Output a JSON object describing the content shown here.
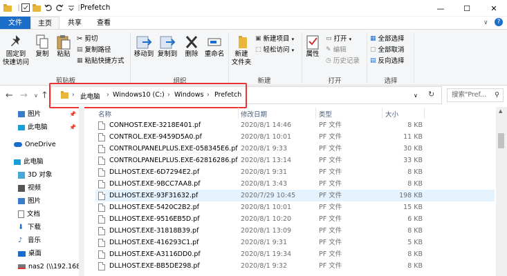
{
  "window": {
    "title": "Prefetch",
    "minimize": "—",
    "maximize": "☐",
    "close": "✕"
  },
  "tabs": [
    {
      "label": "文件"
    },
    {
      "label": "主页"
    },
    {
      "label": "共享"
    },
    {
      "label": "查看"
    }
  ],
  "ribbon": {
    "clipboard": {
      "pin_label": "固定到\n快速访问",
      "copy_label": "复制",
      "paste_label": "粘贴",
      "cut": "剪切",
      "copy_path": "复制路径",
      "paste_shortcut": "粘贴快捷方式",
      "group_label": "剪贴板"
    },
    "organize": {
      "move_to": "移动到",
      "copy_to": "复制到",
      "delete": "删除",
      "rename": "重命名",
      "group_label": "组织"
    },
    "new": {
      "new_folder": "新建\n文件夹",
      "new_item": "新建项目",
      "easy_access": "轻松访问",
      "group_label": "新建"
    },
    "open": {
      "properties": "属性",
      "open": "打开",
      "edit": "编辑",
      "history": "历史记录",
      "group_label": "打开"
    },
    "select": {
      "select_all": "全部选择",
      "select_none": "全部取消",
      "invert": "反向选择",
      "group_label": "选择"
    }
  },
  "address": {
    "crumbs": [
      "此电脑",
      "Windows10 (C:)",
      "Windows",
      "Prefetch"
    ],
    "search_placeholder": "搜索\"Pref..."
  },
  "sidebar": {
    "items": [
      {
        "label": "图片"
      },
      {
        "label": "此电脑"
      },
      {
        "label": "OneDrive"
      },
      {
        "label": "此电脑"
      },
      {
        "label": "3D 对象"
      },
      {
        "label": "视频"
      },
      {
        "label": "图片"
      },
      {
        "label": "文档"
      },
      {
        "label": "下载"
      },
      {
        "label": "音乐"
      },
      {
        "label": "桌面"
      },
      {
        "label": "nas2 (\\\\192.168"
      }
    ]
  },
  "columns": {
    "name": "名称",
    "date": "修改日期",
    "type": "类型",
    "size": "大小"
  },
  "files": [
    {
      "name": "CONHOST.EXE-3218E401.pf",
      "date": "2020/8/1 14:46",
      "type": "PF 文件",
      "size": "8 KB"
    },
    {
      "name": "CONTROL.EXE-9459D5A0.pf",
      "date": "2020/8/1 10:01",
      "type": "PF 文件",
      "size": "11 KB"
    },
    {
      "name": "CONTROLPANELPLUS.EXE-058345E6.pf",
      "date": "2020/8/1 9:33",
      "type": "PF 文件",
      "size": "30 KB"
    },
    {
      "name": "CONTROLPANELPLUS.EXE-62816286.pf",
      "date": "2020/8/1 13:14",
      "type": "PF 文件",
      "size": "33 KB"
    },
    {
      "name": "DLLHOST.EXE-6D7294E2.pf",
      "date": "2020/8/1 9:31",
      "type": "PF 文件",
      "size": "8 KB"
    },
    {
      "name": "DLLHOST.EXE-9BCC7AA8.pf",
      "date": "2020/8/1 3:43",
      "type": "PF 文件",
      "size": "8 KB"
    },
    {
      "name": "DLLHOST.EXE-93F31632.pf",
      "date": "2020/7/29 10:45",
      "type": "PF 文件",
      "size": "198 KB"
    },
    {
      "name": "DLLHOST.EXE-5420C2B2.pf",
      "date": "2020/8/1 10:01",
      "type": "PF 文件",
      "size": "15 KB"
    },
    {
      "name": "DLLHOST.EXE-9516EB5D.pf",
      "date": "2020/8/1 10:20",
      "type": "PF 文件",
      "size": "6 KB"
    },
    {
      "name": "DLLHOST.EXE-31818B39.pf",
      "date": "2020/8/1 13:09",
      "type": "PF 文件",
      "size": "8 KB"
    },
    {
      "name": "DLLHOST.EXE-416293C1.pf",
      "date": "2020/8/1 9:31",
      "type": "PF 文件",
      "size": "5 KB"
    },
    {
      "name": "DLLHOST.EXE-A3116DD0.pf",
      "date": "2020/8/1 19:34",
      "type": "PF 文件",
      "size": "8 KB"
    },
    {
      "name": "DLLHOST.EXE-BB5DE298.pf",
      "date": "2020/8/1 9:32",
      "type": "PF 文件",
      "size": "8 KB"
    }
  ],
  "colors": {
    "accent": "#1a6dc9",
    "highlight_box": "#e33333",
    "selected_row": "#e5f3ff"
  }
}
